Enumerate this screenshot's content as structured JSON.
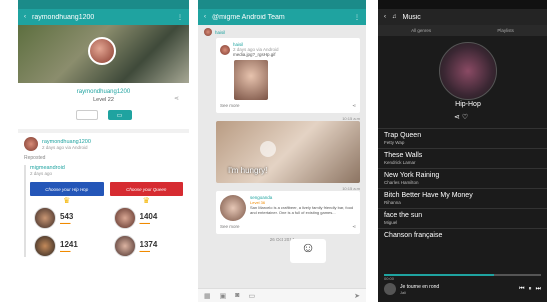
{
  "phone1": {
    "username_title": "raymondhuang1200",
    "profile_name": "raymondhuang1200",
    "level": "Level 22",
    "post": {
      "author": "raymondhuang1200",
      "time": "2 days ago via Android",
      "reposted": "Reposted",
      "inner_author": "migmeandroid",
      "inner_time": "2 days ago",
      "banner_left": "Choose your Hip Hop",
      "banner_right": "Choose your Queen",
      "counts": [
        "543",
        "1404",
        "1241",
        "1374"
      ]
    }
  },
  "phone2": {
    "title": "@migme Android Team",
    "msg1_name": "haisil",
    "msg1_time": "2 days ago via Android",
    "msg1_media": "media.jpg?_rgsHp.gif",
    "see_more": "See more",
    "t1": "10:15 a.m",
    "caption": "I'm hungry!",
    "t2": "10:15 a.m",
    "msg3_name": "sengoanda",
    "msg3_level": "Level 36",
    "msg3_text": "San Marcelo is a craftbeer, a lively family friendly bar, food and entertainer. One is a full of existing games...",
    "date_sep": "26 Oct 2014"
  },
  "phone3": {
    "title": "Music",
    "tabs": [
      "All genres",
      "Playlists"
    ],
    "genre": "Hip-Hop",
    "songs": [
      {
        "title": "Trap Queen",
        "artist": "Fetty Wap"
      },
      {
        "title": "These Walls",
        "artist": "Kendrick Lamar"
      },
      {
        "title": "New York Raining",
        "artist": "Charles Hamilton"
      },
      {
        "title": "Bitch Better Have My Money",
        "artist": "Rihanna"
      },
      {
        "title": "face the sun",
        "artist": "Miguel"
      },
      {
        "title": "Chanson française",
        "artist": ""
      }
    ],
    "now_playing": "Je tourne en rond",
    "now_artist": "Jali",
    "time_elapsed": "00:00",
    "time_total": "",
    "progress": 0.7
  }
}
